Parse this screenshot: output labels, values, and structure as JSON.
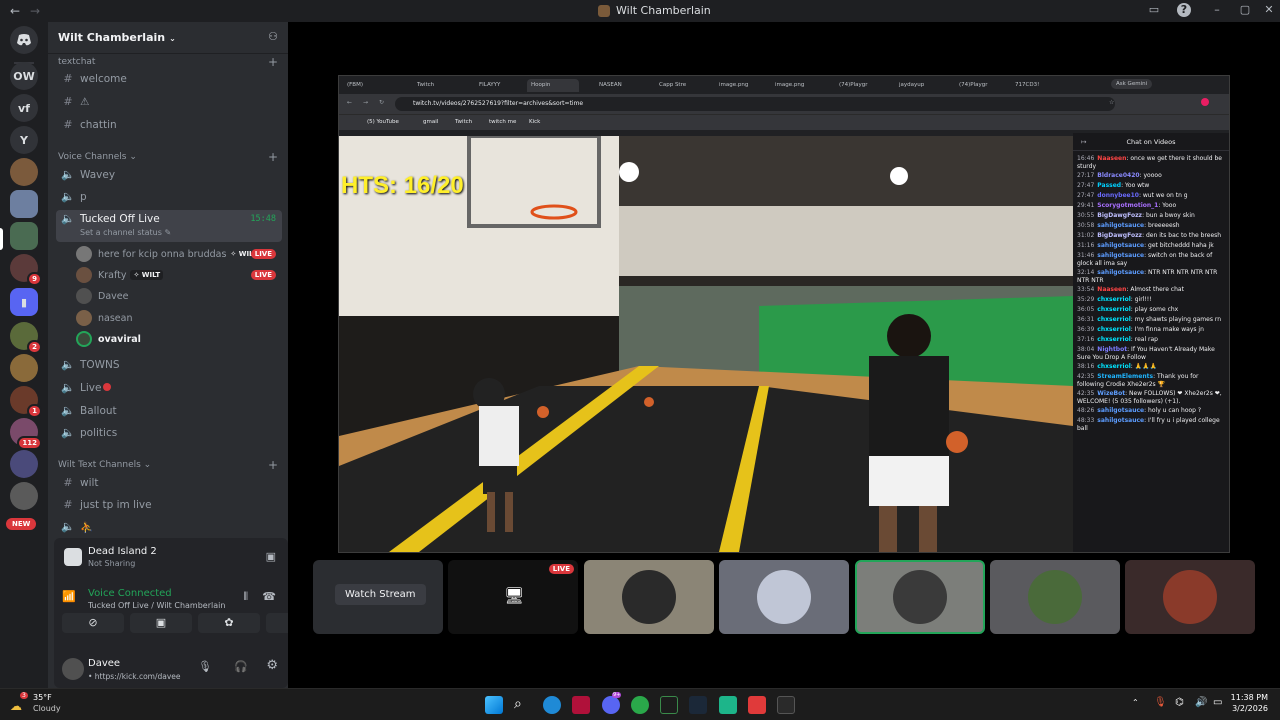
{
  "window": {
    "title": "Wilt Chamberlain"
  },
  "guilds": [
    {
      "label": "OW"
    },
    {
      "label": "vf"
    },
    {
      "label": "Y"
    }
  ],
  "guild_badges": [
    "9",
    "2",
    "1",
    "112"
  ],
  "new_badge": "NEW",
  "server": {
    "name": "Wilt Chamberlain",
    "categories": {
      "textchat": "textchat",
      "voice": "Voice Channels",
      "wilt_text": "Wilt Text Channels"
    },
    "text_channels": [
      "welcome",
      "⚠",
      "chattin"
    ],
    "voice_channels": [
      "Wavey",
      "p"
    ],
    "selected_channel": {
      "name": "Tucked Off Live",
      "time": "15:48",
      "status": "Set a channel status"
    },
    "voice_users": [
      {
        "name": "here for kcip onna bruddas",
        "tag": "WILT",
        "live": "LIVE"
      },
      {
        "name": "Krafty",
        "tag": "WILT",
        "live": "LIVE"
      },
      {
        "name": "Davee"
      },
      {
        "name": "nasean"
      },
      {
        "name": "ovaviral"
      }
    ],
    "more_voice": [
      "TOWNS",
      "Live",
      "Ballout",
      "politics"
    ],
    "wilt_channels": [
      "wilt",
      "just tp im live",
      "⛹"
    ]
  },
  "activity": {
    "game": "Dead Island 2",
    "sub": "Not Sharing"
  },
  "voice_connected": {
    "title": "Voice Connected",
    "sub": "Tucked Off Live / Wilt Chamberlain"
  },
  "user": {
    "name": "Davee",
    "status": "• https://kick.com/davee"
  },
  "browser": {
    "tabs": [
      "(FBM)",
      "Twitch",
      "FILAYYY",
      "Hoopin",
      "NASEAN",
      "Capp Stre",
      "image.png",
      "image.png",
      "(74)Playgr",
      "jaydayup",
      "(74)Playgr",
      "717CD3!"
    ],
    "gemini": "Ask Gemini",
    "url": "twitch.tv/videos/2762527619?filter=archives&sort=time",
    "bookmarks": [
      "(5) YouTube",
      "gmail",
      "Twitch",
      "twitch me",
      "Kick"
    ],
    "overlay": "HTS: 16/20"
  },
  "chat": {
    "title": "Chat on Videos",
    "messages": [
      {
        "t": "16:46",
        "u": "Naaseen",
        "c": "#ff4545",
        "m": "once we get there it should be sturdy"
      },
      {
        "t": "27:17",
        "u": "Bldrace0420",
        "c": "#8a8aff",
        "m": "yoooo"
      },
      {
        "t": "27:47",
        "u": "Passed",
        "c": "#00d0ff",
        "m": "Yoo wtw"
      },
      {
        "t": "27:47",
        "u": "donnybee10",
        "c": "#6b6bff",
        "m": "wut we on tn g"
      },
      {
        "t": "29:41",
        "u": "Scorygotmotion_1",
        "c": "#a970ff",
        "m": "Yooo"
      },
      {
        "t": "30:55",
        "u": "BigDawgFozz",
        "c": "#bfbfff",
        "m": "bun a bwoy skin"
      },
      {
        "t": "30:58",
        "u": "sahilgotsauce",
        "c": "#5c9cff",
        "m": "breeeeesh"
      },
      {
        "t": "31:02",
        "u": "BigDawgFozz",
        "c": "#bfbfff",
        "m": "den its bac to the breesh"
      },
      {
        "t": "31:16",
        "u": "sahilgotsauce",
        "c": "#5c9cff",
        "m": "get bitcheddd haha jk"
      },
      {
        "t": "31:46",
        "u": "sahilgotsauce",
        "c": "#5c9cff",
        "m": "switch on the back of glock all ima say"
      },
      {
        "t": "32:14",
        "u": "sahilgotsauce",
        "c": "#5c9cff",
        "m": "NTR NTR NTR NTR NTR NTR NTR"
      },
      {
        "t": "33:54",
        "u": "Naaseen",
        "c": "#ff4545",
        "m": "Almost there chat"
      },
      {
        "t": "35:29",
        "u": "chxserriol",
        "c": "#00e5ff",
        "m": "girl!!!"
      },
      {
        "t": "36:05",
        "u": "chxserriol",
        "c": "#00e5ff",
        "m": "play some chx"
      },
      {
        "t": "36:31",
        "u": "chxserriol",
        "c": "#00e5ff",
        "m": "my shawts playing games rn"
      },
      {
        "t": "36:39",
        "u": "chxserriol",
        "c": "#00e5ff",
        "m": "I'm finna make ways jn"
      },
      {
        "t": "37:16",
        "u": "chxserriol",
        "c": "#00e5ff",
        "m": "real rap"
      },
      {
        "t": "38:04",
        "u": "Nightbot",
        "c": "#7c7cff",
        "m": "If You Haven't Already Make Sure You Drop A Follow"
      },
      {
        "t": "38:16",
        "u": "chxserriol",
        "c": "#00e5ff",
        "m": "🙏🙏🙏"
      },
      {
        "t": "42:35",
        "u": "StreamElements",
        "c": "#1fb5ff",
        "m": "Thank you for following Crodie Xhe2er2s 🏆"
      },
      {
        "t": "42:35",
        "u": "WizeBot",
        "c": "#5f9fff",
        "m": "New FOLLOWS) ❤ Xhe2er2s ❤, WELCOME! (5 035 followers) (+1)."
      },
      {
        "t": "48:26",
        "u": "sahilgotsauce",
        "c": "#5c9cff",
        "m": "holy u can hoop ?"
      },
      {
        "t": "48:33",
        "u": "sahilgotsauce",
        "c": "#5c9cff",
        "m": "I'll fry u i played college ball"
      }
    ]
  },
  "tiles": {
    "watch": "Watch Stream",
    "live": "LIVE"
  },
  "taskbar": {
    "weather_temp": "35°F",
    "weather_desc": "Cloudy",
    "time": "11:38 PM",
    "date": "3/2/2026",
    "weather_badge": "3",
    "discord_badge": "9+"
  },
  "colors": {
    "accent_green": "#23a559",
    "live_red": "#da373c",
    "bg": "#1e1f22"
  }
}
